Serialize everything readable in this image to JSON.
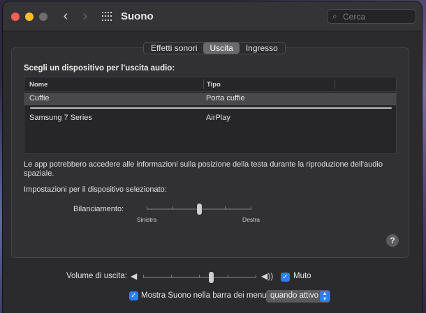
{
  "window": {
    "title": "Suono",
    "search_placeholder": "Cerca"
  },
  "tabs": [
    {
      "label": "Effetti sonori",
      "active": false
    },
    {
      "label": "Uscita",
      "active": true
    },
    {
      "label": "Ingresso",
      "active": false
    }
  ],
  "output": {
    "heading": "Scegli un dispositivo per l'uscita audio:",
    "columns": [
      "Nome",
      "Tipo"
    ],
    "devices": [
      {
        "name": "Cuffie",
        "type": "Porta cuffie",
        "selected": true
      },
      {
        "name": "Samsung 7 Series",
        "type": "AirPlay",
        "selected": false
      }
    ],
    "info_text": "Le app potrebbero accedere alle informazioni sulla posizione della testa durante la riproduzione dell'audio spaziale.",
    "settings_label": "Impostazioni per il dispositivo selezionato:",
    "balance": {
      "label": "Bilanciamento:",
      "left_label": "Sinistra",
      "right_label": "Destra",
      "value": 0.5
    }
  },
  "footer": {
    "volume_label": "Volume di uscita:",
    "volume_value": 0.6,
    "mute_label": "Muto",
    "mute_checked": true,
    "show_menu_label": "Mostra Suono nella barra dei menu",
    "show_menu_checked": true,
    "show_menu_option": "quando attivo"
  },
  "icons": {
    "help": "?",
    "check": "✓"
  },
  "colors": {
    "accent": "#2d7ef7",
    "close": "#fe5f57",
    "minimize": "#febc2e"
  }
}
